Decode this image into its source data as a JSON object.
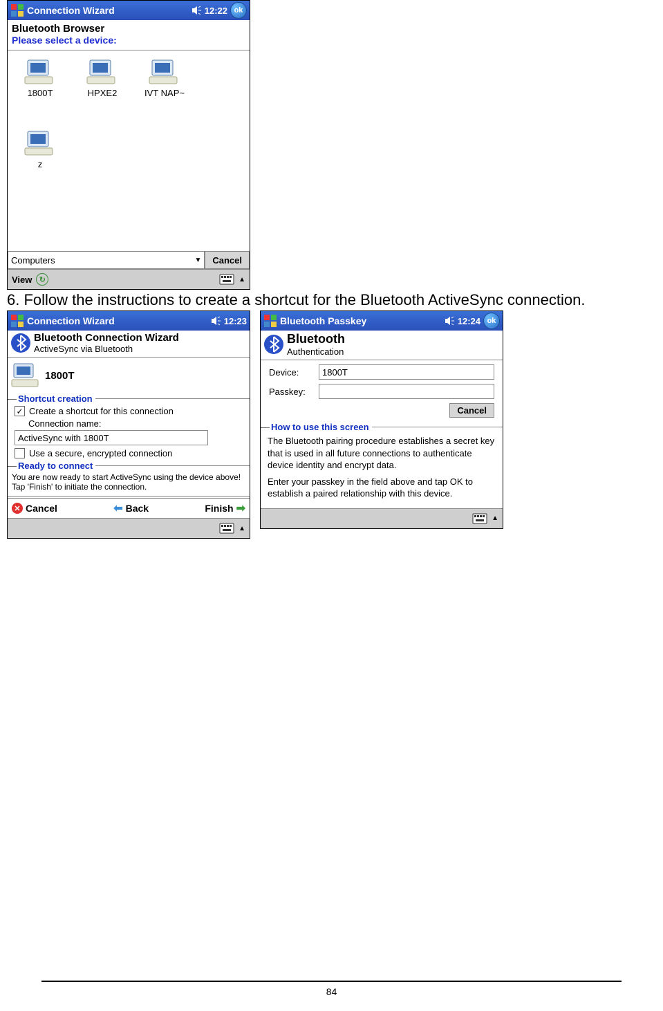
{
  "instruction_text": "6. Follow the instructions to create a shortcut for the Bluetooth ActiveSync connection.",
  "page_number": "84",
  "screen1": {
    "title": "Connection Wizard",
    "time": "12:22",
    "ok": "ok",
    "heading": "Bluetooth Browser",
    "prompt": "Please select a device:",
    "devices": [
      "1800T",
      "HPXE2",
      "IVT NAP~",
      "z"
    ],
    "filter_value": "Computers",
    "cancel": "Cancel",
    "view_label": "View"
  },
  "screen2": {
    "title": "Connection Wizard",
    "time": "12:23",
    "wiz_title": "Bluetooth Connection Wizard",
    "wiz_sub": "ActiveSync via Bluetooth",
    "device_name": "1800T",
    "group1": "Shortcut creation",
    "chk_create_label": "Create a shortcut for this connection",
    "conn_name_label": "Connection name:",
    "conn_name_value": "ActiveSync with 1800T",
    "chk_secure_label": "Use a secure, encrypted connection",
    "group2": "Ready to connect",
    "ready_text": "You are now ready to start ActiveSync using the device above! Tap 'Finish' to initiate the connection.",
    "cmd_cancel": "Cancel",
    "cmd_back": "Back",
    "cmd_finish": "Finish"
  },
  "screen3": {
    "title": "Bluetooth Passkey",
    "time": "12:24",
    "ok": "ok",
    "bt_title": "Bluetooth",
    "bt_sub": "Authentication",
    "device_label": "Device:",
    "device_value": "1800T",
    "passkey_label": "Passkey:",
    "passkey_value": "",
    "cancel": "Cancel",
    "group": "How to use this screen",
    "para1": "The Bluetooth pairing procedure establishes a secret key that is used in all future connections to authenticate device identity and encrypt data.",
    "para2": "Enter your passkey in the field above and tap OK to establish a paired relationship with this device."
  }
}
